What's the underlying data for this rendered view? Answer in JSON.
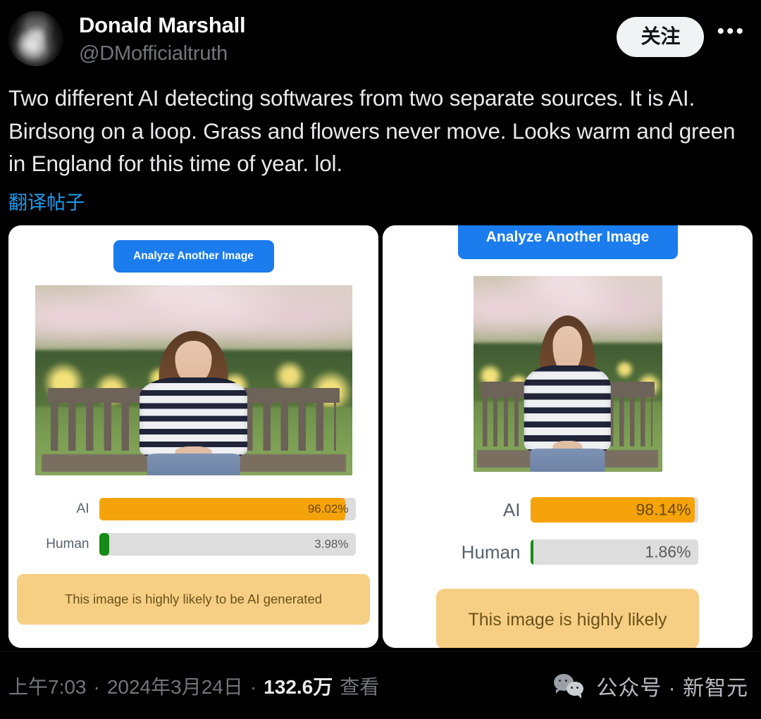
{
  "header": {
    "display_name": "Donald Marshall",
    "handle": "@DMofficialtruth",
    "follow_label": "关注",
    "more_label": "•••",
    "avatar_alt": "avatar"
  },
  "post": {
    "text": "Two different AI detecting softwares from two separate  sources.  It is AI.  Birdsong on a loop. Grass and flowers never move. Looks warm and green in England for this time of year. lol.",
    "translate_label": "翻译帖子"
  },
  "media": {
    "left_panel": {
      "analyze_button": "Analyze Another Image",
      "photo_alt": "woman sitting on a garden bench, wide crop",
      "bars": [
        {
          "label": "AI",
          "value": "96.02%",
          "percent": 96.02,
          "color": "#f5a30a",
          "value_on_fill": true
        },
        {
          "label": "Human",
          "value": "3.98%",
          "percent": 3.98,
          "color": "#168c16",
          "value_on_fill": false
        }
      ],
      "verdict": "This image is highly likely to be AI generated"
    },
    "right_panel": {
      "analyze_button": "Analyze Another Image",
      "photo_alt": "woman sitting on a garden bench, square crop",
      "bars": [
        {
          "label": "AI",
          "value": "98.14%",
          "percent": 98.14,
          "color": "#f5a30a",
          "value_on_fill": true
        },
        {
          "label": "Human",
          "value": "1.86%",
          "percent": 1.86,
          "color": "#168c16",
          "value_on_fill": false
        }
      ],
      "verdict": "This image is highly likely"
    }
  },
  "footer": {
    "time": "上午7:03",
    "separator1": "·",
    "date": "2024年3月24日",
    "separator2": "·",
    "views_count": "132.6万",
    "views_label": "查看",
    "watermark": "公众号 · 新智元"
  },
  "colors": {
    "background": "#000000",
    "text": "#e7e9ea",
    "muted": "#71767b",
    "link": "#1d9bf0",
    "follow_bg": "#eff3f4",
    "button_blue": "#1b7ced",
    "ai_orange": "#f5a30a",
    "human_green": "#168c16",
    "track_gray": "#dddddd",
    "verdict_bg": "#f7cf84"
  }
}
